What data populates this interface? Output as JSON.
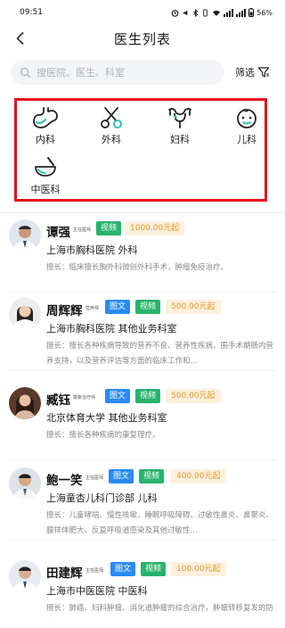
{
  "status_bar": {
    "time": "09:51",
    "battery": "56%"
  },
  "header": {
    "title": "医生列表"
  },
  "search": {
    "placeholder": "搜医院、医生、科室",
    "filter_label": "筛选"
  },
  "departments": [
    {
      "label": "内科",
      "icon": "stomach-icon"
    },
    {
      "label": "外科",
      "icon": "scissors-icon"
    },
    {
      "label": "妇科",
      "icon": "uterus-icon"
    },
    {
      "label": "儿科",
      "icon": "baby-face-icon"
    },
    {
      "label": "中医科",
      "icon": "mortar-icon"
    }
  ],
  "doctors": [
    {
      "name": "谭强",
      "title": "主任医师",
      "tags": [
        "视频"
      ],
      "price": "1000.00元起",
      "hospital": "上海市胸科医院 外科",
      "skill": "擅长：临床擅长胸外科微创外科手术，肿瘤免疫治疗。"
    },
    {
      "name": "周辉辉",
      "title": "营养师",
      "tags": [
        "图文",
        "视频"
      ],
      "price": "500.00元起",
      "hospital": "上海市胸科医院 其他业务科室",
      "skill": "擅长：擅长各种疾病导致的营养不良、营养性疾病、围手术期肠内营养支持，以及营养评估等方面的临床工作和..."
    },
    {
      "name": "臧钰",
      "title": "康复治疗师",
      "tags": [
        "图文",
        "视频"
      ],
      "price": "500.00元起",
      "hospital": "北京体育大学 其他业务科室",
      "skill": "擅长：擅长各种疾病的康复理疗。"
    },
    {
      "name": "鲍一笑",
      "title": "主任医师",
      "tags": [
        "图文",
        "视频"
      ],
      "price": "400.00元起",
      "hospital": "上海童杏儿科门诊部 儿科",
      "skill": "擅长：儿童哮喘、慢性咳嗽、睡眠呼吸障碍、过敏性鼻炎、鼻窦炎、腺样体肥大、反复呼吸道感染及其他过敏性..."
    },
    {
      "name": "田建辉",
      "title": "主任医师",
      "tags": [
        "图文",
        "视频"
      ],
      "price": "100.00元起",
      "hospital": "上海市中医医院 中医科",
      "skill": "擅长：肺癌、妇科肿瘤、消化道肿瘤的综合治疗，肿瘤转移复发的防治。"
    }
  ],
  "colors": {
    "accent_teal": "#1fbfa8",
    "tag_blue": "#2a8bf2",
    "tag_green": "#27b36c",
    "price_text": "#e09a2a",
    "highlight_border": "#e5101b"
  }
}
